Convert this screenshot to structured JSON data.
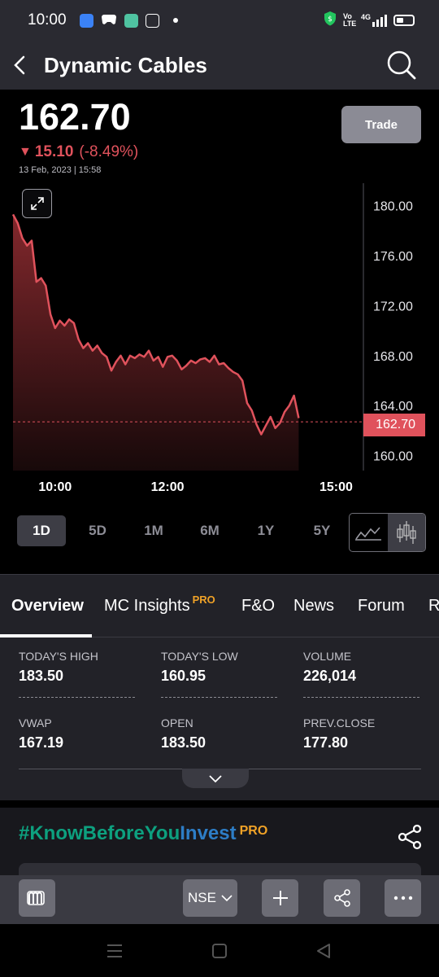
{
  "status_bar": {
    "time": "10:00",
    "network": "4G",
    "volte": "Vo LTE"
  },
  "header": {
    "title": "Dynamic Cables"
  },
  "quote": {
    "price": "162.70",
    "change_abs": "15.10",
    "change_pct": "(-8.49%)",
    "timestamp": "13 Feb, 2023 | 15:58",
    "trade_label": "Trade"
  },
  "chart_data": {
    "type": "area",
    "title": "",
    "x_ticks": [
      "10:00",
      "12:00",
      "15:00"
    ],
    "y_ticks": [
      "180.00",
      "176.00",
      "172.00",
      "168.00",
      "164.00",
      "160.00"
    ],
    "ylim": [
      158.8,
      181.8
    ],
    "last_price_label": "162.70",
    "last_price": 162.7,
    "line_color": "#e0525c",
    "x": [
      "09:15",
      "09:20",
      "09:25",
      "09:30",
      "09:35",
      "09:40",
      "09:45",
      "09:50",
      "09:55",
      "10:00",
      "10:05",
      "10:10",
      "10:15",
      "10:20",
      "10:25",
      "10:30",
      "10:35",
      "10:40",
      "10:45",
      "10:50",
      "10:55",
      "11:00",
      "11:05",
      "11:10",
      "11:15",
      "11:20",
      "11:25",
      "11:30",
      "11:35",
      "11:40",
      "11:45",
      "11:50",
      "11:55",
      "12:00",
      "12:05",
      "12:10",
      "12:15",
      "12:20",
      "12:25",
      "12:30",
      "12:35",
      "12:40",
      "12:45",
      "12:50",
      "12:55",
      "13:00",
      "13:05",
      "13:10",
      "13:15",
      "13:20",
      "13:25",
      "13:30",
      "13:35",
      "13:40",
      "13:45",
      "13:50",
      "13:55",
      "14:00",
      "14:05",
      "14:10",
      "14:15",
      "14:20",
      "14:25",
      "14:30",
      "14:35",
      "14:40",
      "14:45",
      "14:50",
      "14:55",
      "15:00",
      "15:05",
      "15:10",
      "15:15",
      "15:20",
      "15:25",
      "15:30"
    ],
    "y": [
      179.3,
      178.6,
      177.4,
      176.8,
      177.2,
      173.9,
      174.2,
      173.6,
      171.3,
      170.2,
      170.8,
      170.4,
      170.9,
      170.6,
      169.3,
      168.6,
      169.0,
      168.4,
      168.8,
      168.2,
      167.9,
      166.8,
      167.5,
      168.0,
      167.3,
      168.0,
      167.8,
      168.1,
      167.9,
      168.4,
      167.6,
      167.9,
      167.1,
      167.9,
      168.0,
      167.6,
      166.9,
      167.2,
      167.6,
      167.4,
      167.7,
      167.8,
      167.5,
      168.0,
      167.3,
      167.4,
      167.0,
      166.7,
      166.5,
      166.0,
      164.2,
      163.6,
      162.5,
      161.7,
      162.4,
      163.1,
      162.2,
      162.6,
      163.5,
      164.0,
      164.8,
      163.0
    ]
  },
  "ranges": [
    "1D",
    "5D",
    "1M",
    "6M",
    "1Y",
    "5Y"
  ],
  "tabs": [
    {
      "label": "Overview",
      "pro": ""
    },
    {
      "label": "MC Insights",
      "pro": "PRO"
    },
    {
      "label": "F&O",
      "pro": ""
    },
    {
      "label": "News",
      "pro": ""
    },
    {
      "label": "Forum",
      "pro": ""
    },
    {
      "label": "R",
      "pro": ""
    }
  ],
  "stats": [
    {
      "label": "TODAY'S HIGH",
      "value": "183.50"
    },
    {
      "label": "TODAY'S LOW",
      "value": "160.95"
    },
    {
      "label": "VOLUME",
      "value": "226,014"
    },
    {
      "label": "VWAP",
      "value": "167.19"
    },
    {
      "label": "OPEN",
      "value": "183.50"
    },
    {
      "label": "PREV.CLOSE",
      "value": "177.80"
    }
  ],
  "kbyi": {
    "part1": "#KnowBeforeYou",
    "part2": "Invest",
    "pro": "PRO"
  },
  "toolbar": {
    "exchange": "NSE"
  },
  "colors": {
    "accent_red": "#e0525c",
    "pro_orange": "#f0a227",
    "kbyi_green": "#0da07f",
    "kbyi_blue": "#2d7dc6"
  }
}
